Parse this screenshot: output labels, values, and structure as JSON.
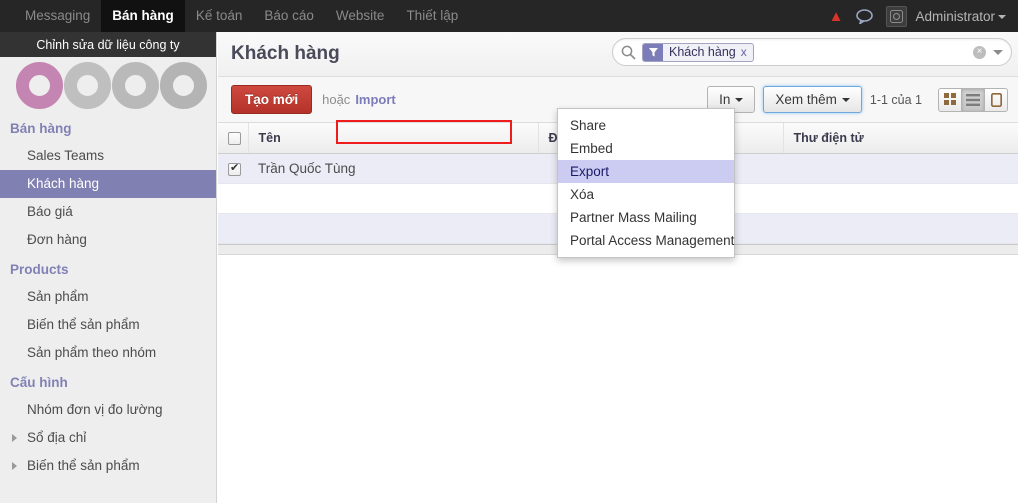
{
  "topbar": {
    "nav": [
      {
        "label": "Messaging",
        "active": false
      },
      {
        "label": "Bán hàng",
        "active": true
      },
      {
        "label": "Kế toán",
        "active": false
      },
      {
        "label": "Báo cáo",
        "active": false
      },
      {
        "label": "Website",
        "active": false
      },
      {
        "label": "Thiết lập",
        "active": false
      }
    ],
    "warning_icon": "warning-triangle-icon",
    "chat_icon": "chat-bubble-icon",
    "avatar_icon": "user-avatar-icon",
    "user": "Administrator",
    "accent_color": "#d9342b"
  },
  "sidebar": {
    "company_bar": "Chỉnh sửa dữ liệu công ty",
    "logo": {
      "name": "odoo-logo",
      "rings": [
        "#c585b2",
        "#bfbfbf",
        "#b9b9b9",
        "#b4b4b4"
      ]
    },
    "groups": [
      {
        "title": "Bán hàng",
        "items": [
          {
            "label": "Sales Teams",
            "active": false,
            "expandable": false
          },
          {
            "label": "Khách hàng",
            "active": true,
            "expandable": false
          },
          {
            "label": "Báo giá",
            "active": false,
            "expandable": false
          },
          {
            "label": "Đơn hàng",
            "active": false,
            "expandable": false
          }
        ]
      },
      {
        "title": "Products",
        "items": [
          {
            "label": "Sản phẩm",
            "active": false,
            "expandable": false
          },
          {
            "label": "Biến thể sản phẩm",
            "active": false,
            "expandable": false
          },
          {
            "label": "Sản phẩm theo nhóm",
            "active": false,
            "expandable": false
          }
        ]
      },
      {
        "title": "Cấu hình",
        "items": [
          {
            "label": "Nhóm đơn vị đo lường",
            "active": false,
            "expandable": false
          },
          {
            "label": "Sổ địa chỉ",
            "active": false,
            "expandable": true
          },
          {
            "label": "Biến thể sản phẩm",
            "active": false,
            "expandable": true
          }
        ]
      }
    ],
    "active_color": "#8080b3",
    "section_color": "#8181b5"
  },
  "content": {
    "page_title": "Khách hàng",
    "search": {
      "magnifier_icon": "search-icon",
      "facet": {
        "filter_icon": "funnel-filter-icon",
        "label": "Khách hàng",
        "remove": "x",
        "icon_bg": "#7c7cb8"
      },
      "clear_icon": "clear-circle-icon",
      "dropdown_icon": "chevron-down-icon"
    },
    "toolbar": {
      "create_label": "Tạo mới",
      "or_label": "hoặc",
      "import_label": "Import",
      "print_label": "In",
      "more_label": "Xem thêm",
      "pager": "1-1 của 1",
      "views": [
        {
          "name": "kanban-view-button",
          "icon": "grid-icon",
          "active": false
        },
        {
          "name": "list-view-button",
          "icon": "list-icon",
          "active": true
        },
        {
          "name": "form-view-button",
          "icon": "form-icon",
          "active": false
        }
      ]
    },
    "dropdown_menu": {
      "items": [
        {
          "label": "Share",
          "highlight": false
        },
        {
          "label": "Embed",
          "highlight": false
        },
        {
          "label": "Export",
          "highlight": true
        },
        {
          "label": "Xóa",
          "highlight": false
        },
        {
          "label": "Partner Mass Mailing",
          "highlight": false
        },
        {
          "label": "Portal Access Management",
          "highlight": false
        }
      ],
      "highlight_bg": "#ccccf2",
      "annotation_color": "#ee1c1c"
    },
    "table": {
      "columns": [
        "",
        "Tên",
        "Điện thoại",
        "Thư điện tử"
      ],
      "rows": [
        {
          "selected": true,
          "name": "Trần Quốc Tùng",
          "phone": "",
          "email": ""
        }
      ]
    }
  }
}
